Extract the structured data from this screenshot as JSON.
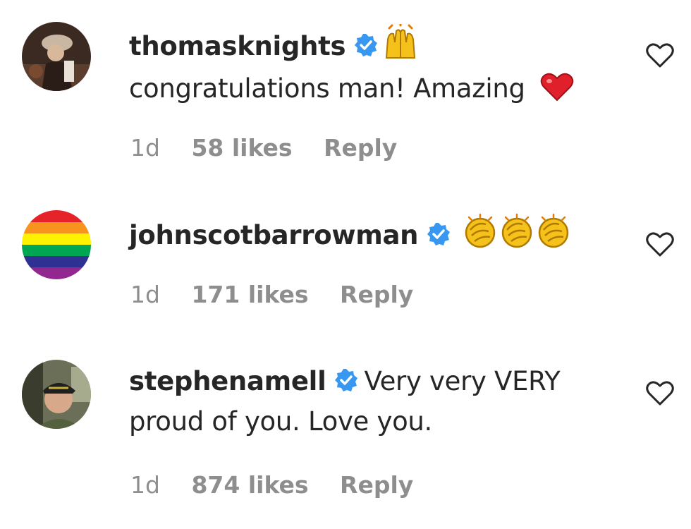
{
  "comments": [
    {
      "username": "thomasknights",
      "verified": true,
      "inline_emoji": [
        "raising-hands-emoji"
      ],
      "text": "congratulations man! Amazing",
      "trailing_emoji": [
        "red-heart-emoji"
      ],
      "time": "1d",
      "likes": "58 likes",
      "reply": "Reply"
    },
    {
      "username": "johnscotbarrowman",
      "verified": true,
      "inline_emoji": [
        "clapping-hands-emoji",
        "clapping-hands-emoji",
        "clapping-hands-emoji"
      ],
      "text": "",
      "time": "1d",
      "likes": "171 likes",
      "reply": "Reply"
    },
    {
      "username": "stephenamell",
      "verified": true,
      "text_line1": "Very very VERY",
      "text_line2": "proud of you. Love you.",
      "time": "1d",
      "likes": "874 likes",
      "reply": "Reply"
    }
  ],
  "colors": {
    "verified_blue": "#3897f0",
    "meta_gray": "#8e8e8e",
    "heart_red": "#e0202a",
    "emoji_yellow": "#f5c21b"
  }
}
